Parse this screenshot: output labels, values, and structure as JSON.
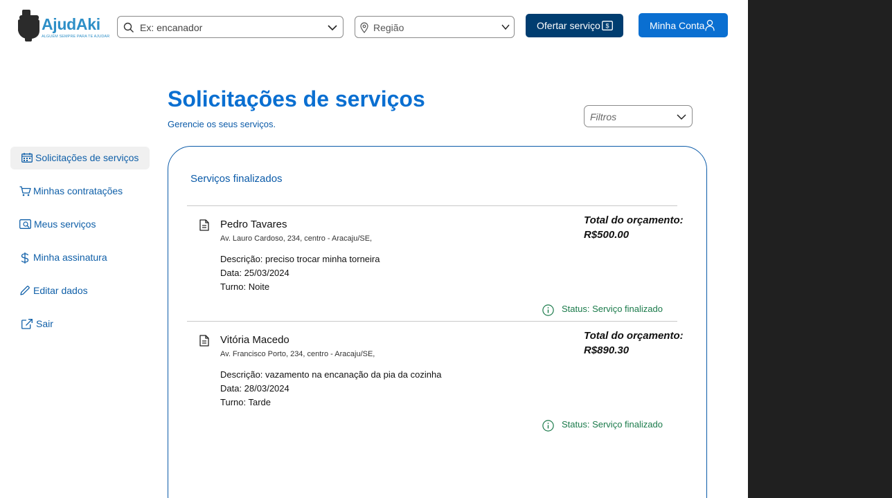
{
  "brand": {
    "name": "AjudAki",
    "tagline": "ALGUÉM SEMPRE PARA TE AJUDAR"
  },
  "header": {
    "search_placeholder": "Ex: encanador",
    "region_placeholder": "Região",
    "offer_button": "Ofertar serviço",
    "account_button": "Minha Conta"
  },
  "sidebar": {
    "items": [
      {
        "label": "Solicitações de serviços",
        "icon": "calendar-icon",
        "active": true
      },
      {
        "label": "Minhas contratações",
        "icon": "cart-icon",
        "active": false
      },
      {
        "label": "Meus serviços",
        "icon": "wallet-icon",
        "active": false
      },
      {
        "label": "Minha assinatura",
        "icon": "dollar-icon",
        "active": false
      },
      {
        "label": "Editar dados",
        "icon": "pencil-icon",
        "active": false
      },
      {
        "label": "Sair",
        "icon": "external-link-icon",
        "active": false
      }
    ]
  },
  "main": {
    "title": "Solicitações de serviços",
    "subtitle": "Gerencie os seus serviços.",
    "filter_label": "Filtros",
    "section_title": "Serviços finalizados",
    "services": [
      {
        "name": "Pedro Tavares",
        "address": "Av. Lauro Cardoso, 234, centro - Aracaju/SE,",
        "description": "Descrição: preciso trocar minha torneira",
        "date": "Data: 25/03/2024",
        "shift": "Turno: Noite",
        "total_label": "Total do orçamento:",
        "total_value": "R$500.00",
        "status": "Status: Serviço finalizado"
      },
      {
        "name": "Vitória Macedo",
        "address": "Av. Francisco Porto, 234, centro - Aracaju/SE,",
        "description": "Descrição: vazamento na encanação da pia da cozinha",
        "date": "Data: 28/03/2024",
        "shift": "Turno: Tarde",
        "total_label": "Total do orçamento:",
        "total_value": "R$890.30",
        "status": "Status: Serviço finalizado"
      }
    ]
  },
  "colors": {
    "primary": "#0a6fd1",
    "dark_primary": "#003d70",
    "status_green": "#1a7a4a",
    "brand_blue": "#2e8fc7"
  }
}
